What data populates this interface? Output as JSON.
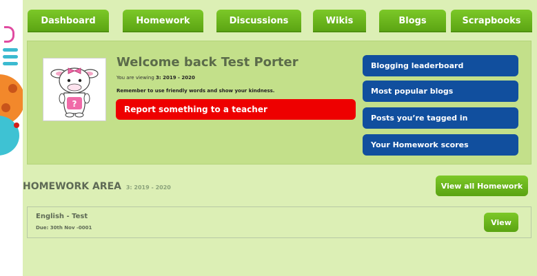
{
  "nav": {
    "tabs": [
      {
        "label": "Dashboard"
      },
      {
        "label": "Homework"
      },
      {
        "label": "Discussions"
      },
      {
        "label": "Wikis"
      },
      {
        "label": "Blogs"
      },
      {
        "label": "Scrapbooks"
      }
    ]
  },
  "welcome": {
    "title": "Welcome back Test Porter",
    "viewing_prefix": "You are viewing",
    "viewing_value": "3: 2019 - 2020",
    "reminder": "Remember to use friendly words and show your kindness.",
    "report_label": "Report something to a teacher",
    "links": [
      {
        "label": "Blogging leaderboard"
      },
      {
        "label": "Most popular blogs"
      },
      {
        "label": "Posts you’re tagged in"
      },
      {
        "label": "Your Homework scores"
      }
    ]
  },
  "homework": {
    "heading": "HOMEWORK AREA",
    "subheading": "3: 2019 - 2020",
    "view_all_label": "View all Homework",
    "items": [
      {
        "title": "English - Test",
        "due": "Due: 30th Nov -0001",
        "view_label": "View"
      }
    ]
  },
  "colors": {
    "tab_green": "#6bb51e",
    "panel_bg": "#dcefb5",
    "welcome_bg": "#c3e08a",
    "link_blue": "#114f9e",
    "report_red": "#ee0000"
  }
}
